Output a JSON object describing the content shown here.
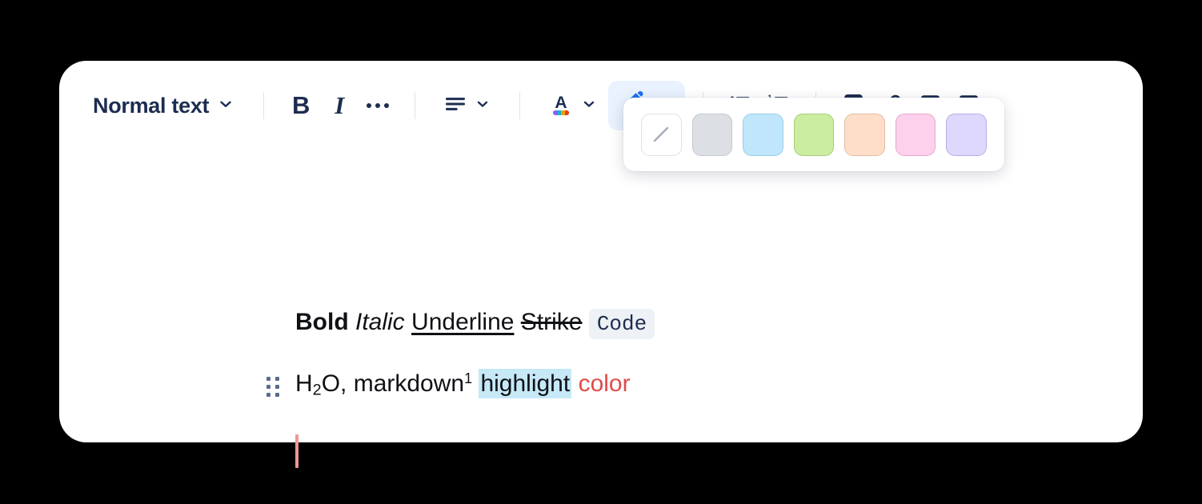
{
  "app": {
    "canvas_background": "#000000",
    "card_background": "#ffffff"
  },
  "toolbar": {
    "style_dropdown": {
      "label": "Normal text",
      "icon": "chevron-down-icon",
      "selected": "Normal text"
    },
    "bold": {
      "label": "B",
      "icon": "bold-icon"
    },
    "italic": {
      "label": "I",
      "icon": "italic-icon"
    },
    "more": {
      "label": "",
      "icon": "ellipsis-icon"
    },
    "align": {
      "label": "",
      "icon": "align-left-icon"
    },
    "text_color": {
      "label": "A",
      "icon": "text-color-icon",
      "accent": "#1d2d50"
    },
    "highlight": {
      "label": "",
      "icon": "highlighter-pen-icon",
      "active": true,
      "active_background": "#e9f2fe",
      "accent": "#1b6ff0"
    },
    "bullet_list": {
      "icon": "bullet-list-icon"
    },
    "numbered_list": {
      "icon": "numbered-list-icon"
    },
    "task_list": {
      "icon": "checkbox-icon"
    },
    "link": {
      "icon": "link-icon"
    },
    "image": {
      "icon": "image-icon"
    },
    "table": {
      "icon": "table-icon"
    }
  },
  "highlight_palette": {
    "visible": true,
    "swatches": [
      {
        "name": "none",
        "color": "#ffffff",
        "label": "No highlight"
      },
      {
        "name": "gray",
        "color": "#dcdfe4",
        "label": "Gray"
      },
      {
        "name": "blue",
        "color": "#bfe6fa",
        "label": "Blue"
      },
      {
        "name": "green",
        "color": "#cbeda0",
        "label": "Green"
      },
      {
        "name": "orange",
        "color": "#fedec8",
        "label": "Orange"
      },
      {
        "name": "pink",
        "color": "#fdd0ec",
        "label": "Pink"
      },
      {
        "name": "purple",
        "color": "#dfd8fd",
        "label": "Purple"
      }
    ]
  },
  "document": {
    "line1": {
      "bold": "Bold",
      "italic": "Italic",
      "underline": "Underline",
      "strike": "Strike",
      "code": "Code"
    },
    "line2": {
      "chem_prefix": "H",
      "chem_sub": "2",
      "chem_suffix": "O,",
      "markdown": "markdown",
      "footnote": "1",
      "highlight": "highlight",
      "highlight_color": "#c6e8f7",
      "color_word": "color",
      "color_word_color": "#e14b4b"
    },
    "caret_color": "#f29497",
    "drag_handle": "drag-handle-icon"
  }
}
